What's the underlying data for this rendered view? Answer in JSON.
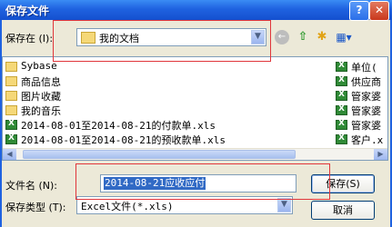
{
  "window": {
    "title": "保存文件",
    "help_glyph": "?",
    "close_glyph": "✕"
  },
  "toolbar": {
    "lookin_label": "保存在 (I):",
    "lookin_value": "我的文档",
    "back_glyph": "←",
    "up_glyph": "⇧",
    "newfolder_glyph": "✱",
    "views_glyph": "▦▾"
  },
  "files": {
    "left": [
      {
        "name": "Sybase",
        "icon": "folder-icon"
      },
      {
        "name": "商品信息",
        "icon": "folder-icon"
      },
      {
        "name": "图片收藏",
        "icon": "pictures-folder-icon"
      },
      {
        "name": "我的音乐",
        "icon": "music-folder-icon"
      },
      {
        "name": "2014-08-01至2014-08-21的付款单.xls",
        "icon": "excel-file-icon"
      },
      {
        "name": "2014-08-01至2014-08-21的预收款单.xls",
        "icon": "excel-file-icon"
      }
    ],
    "right": [
      {
        "name": "单位(",
        "icon": "excel-file-icon"
      },
      {
        "name": "供应商",
        "icon": "excel-file-icon"
      },
      {
        "name": "管家婆",
        "icon": "excel-file-icon"
      },
      {
        "name": "管家婆",
        "icon": "excel-file-icon"
      },
      {
        "name": "管家婆",
        "icon": "excel-file-icon"
      },
      {
        "name": "客户.x",
        "icon": "excel-file-icon"
      }
    ]
  },
  "form": {
    "filename_label": "文件名 (N):",
    "filename_value": "2014-08-21应收应付",
    "filetype_label": "保存类型 (T):",
    "filetype_value": "Excel文件(*.xls)"
  },
  "buttons": {
    "save": "保存(S)",
    "cancel": "取消"
  },
  "colors": {
    "titlebar": "#1f62e0",
    "selection": "#316ac5",
    "highlight_box": "#e0363b"
  }
}
